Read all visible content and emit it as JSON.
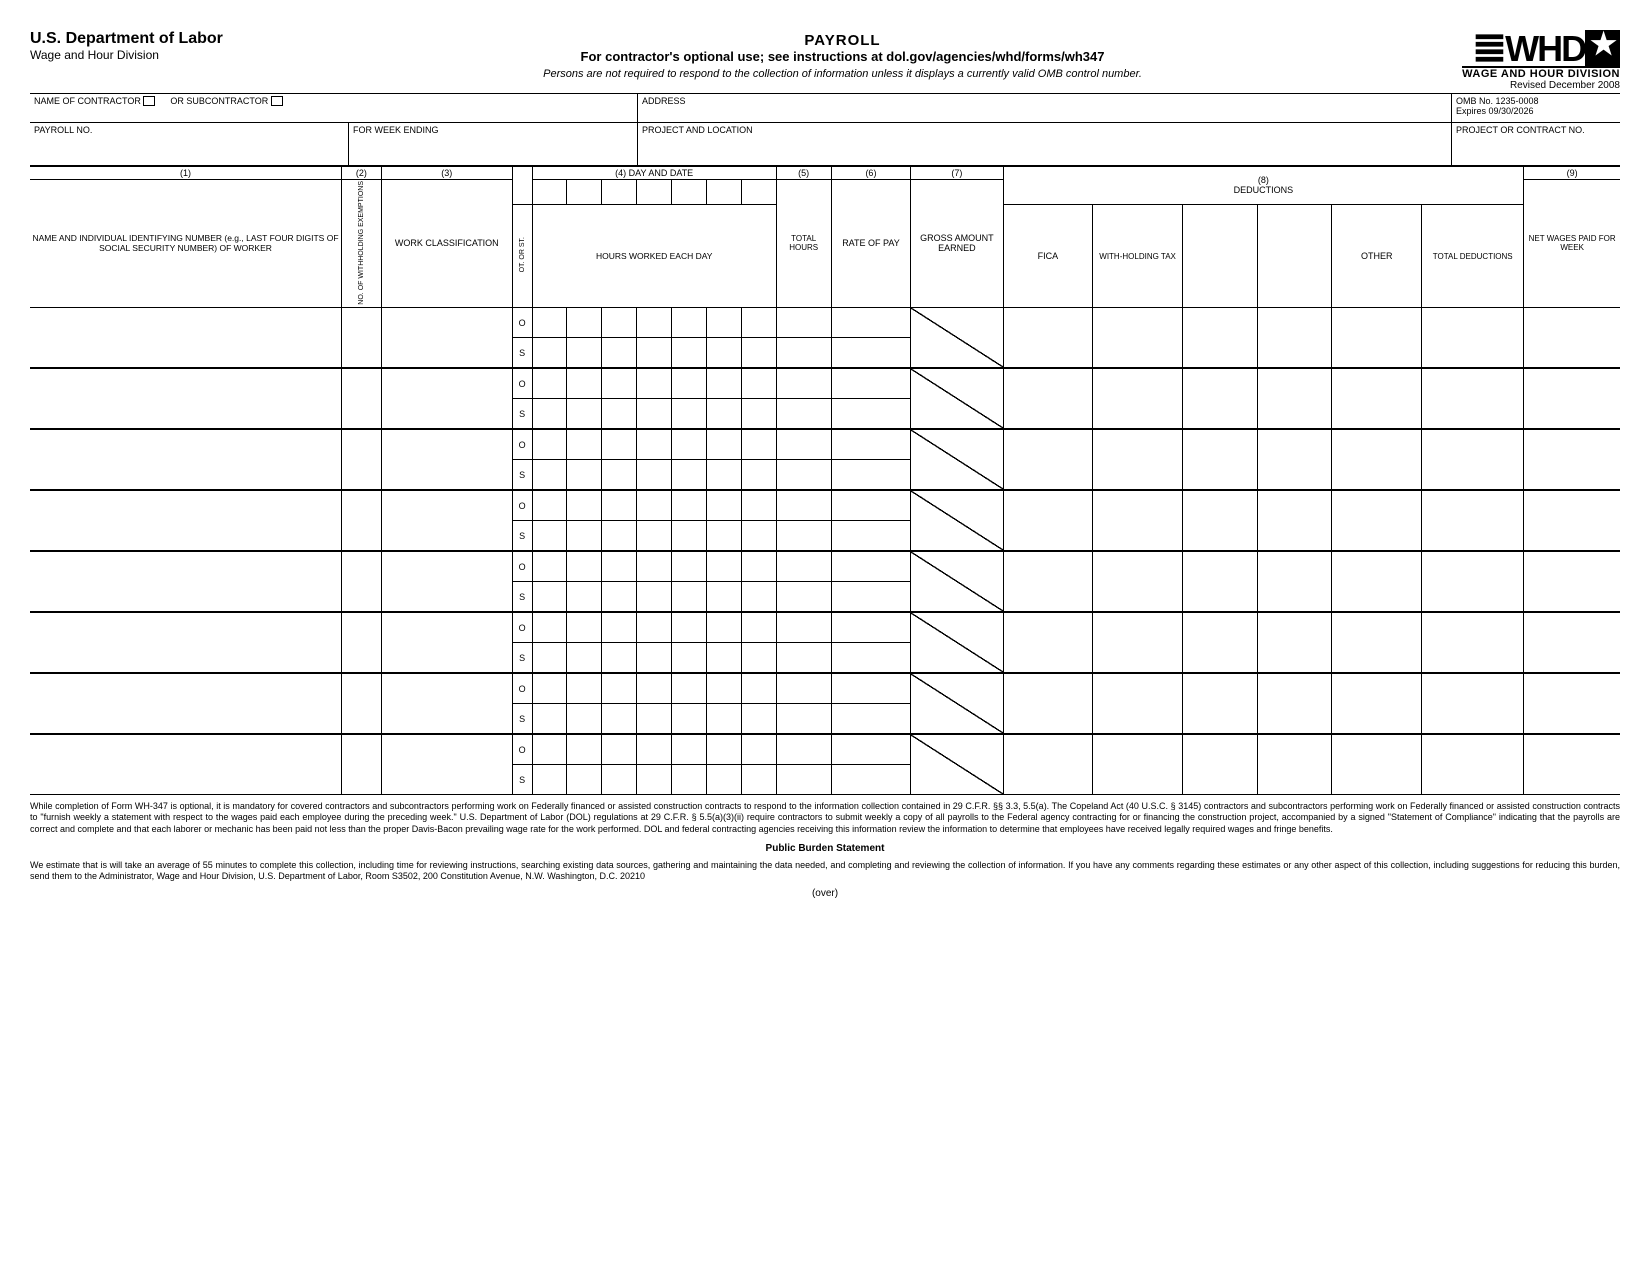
{
  "header": {
    "department": "U.S. Department of Labor",
    "division": "Wage and Hour Division",
    "title": "PAYROLL",
    "subtitle": "For contractor's optional use; see instructions at dol.gov/agencies/whd/forms/wh347",
    "notice": "Persons are not required to respond to the collection of information unless it displays a currently valid OMB control number.",
    "logo_main": "WHD",
    "logo_sub": "WAGE AND HOUR DIVISION",
    "revised": "Revised December 2008"
  },
  "top_fields": {
    "name_contractor": "NAME OF CONTRACTOR",
    "or_subcontractor": "OR SUBCONTRACTOR",
    "address": "ADDRESS",
    "omb_line1": "OMB No. 1235-0008",
    "omb_line2": "Expires 09/30/2026",
    "payroll_no": "PAYROLL NO.",
    "for_week_ending": "FOR WEEK ENDING",
    "project_location": "PROJECT AND LOCATION",
    "project_contract_no": "PROJECT OR CONTRACT NO."
  },
  "columns": {
    "c1_num": "(1)",
    "c1_label": "NAME AND INDIVIDUAL IDENTIFYING NUMBER (e.g., LAST FOUR DIGITS OF SOCIAL SECURITY NUMBER) OF WORKER",
    "c2_num": "(2)",
    "c2_label": "NO. OF WITHHOLDING EXEMPTIONS",
    "c3_num": "(3)",
    "c3_label": "WORK CLASSIFICATION",
    "ot_or_st": "OT. OR ST.",
    "c4_label": "(4) DAY AND DATE",
    "c4_sub": "HOURS WORKED EACH DAY",
    "c5_num": "(5)",
    "c5_label": "TOTAL HOURS",
    "c6_num": "(6)",
    "c6_label": "RATE OF PAY",
    "c7_num": "(7)",
    "c7_label": "GROSS AMOUNT EARNED",
    "c8_num": "(8)",
    "c8_label": "DEDUCTIONS",
    "c8_fica": "FICA",
    "c8_wh": "WITH-HOLDING TAX",
    "c8_other": "OTHER",
    "c8_total": "TOTAL DEDUCTIONS",
    "c9_num": "(9)",
    "c9_label": "NET WAGES PAID FOR WEEK"
  },
  "row_labels": {
    "o": "O",
    "s": "S"
  },
  "footer": {
    "paragraph": "While completion of Form WH-347 is optional, it is mandatory for covered contractors and subcontractors performing work on Federally financed or assisted construction contracts to respond to the information collection contained in 29 C.F.R. §§ 3.3, 5.5(a). The Copeland Act (40 U.S.C. § 3145) contractors and subcontractors performing work on Federally financed or assisted construction contracts to \"furnish weekly a statement with respect to the wages paid each employee during the  preceding week.\"  U.S. Department of Labor (DOL) regulations at 29 C.F.R. § 5.5(a)(3)(ii) require contractors to submit weekly a copy of all payrolls to the Federal agency contracting for or financing the construction project, accompanied by a signed \"Statement of Compliance\" indicating that the payrolls are correct and complete and that each laborer or mechanic has been paid not less than the proper Davis-Bacon prevailing wage rate for the work performed. DOL and federal contracting agencies receiving this information review the information to determine that employees have received legally required wages and fringe benefits.",
    "pbs_title": "Public Burden Statement",
    "pbs_body": "We estimate that is will take an average of 55 minutes to complete this collection, including time for reviewing instructions, searching existing data sources, gathering and maintaining the data needed, and completing and reviewing the collection of information. If you have any comments regarding these estimates or any other aspect of this collection, including suggestions for reducing this burden, send them to the Administrator, Wage and Hour Division, U.S. Department of Labor, Room S3502, 200 Constitution Avenue, N.W. Washington, D.C. 20210",
    "over": "(over)"
  }
}
